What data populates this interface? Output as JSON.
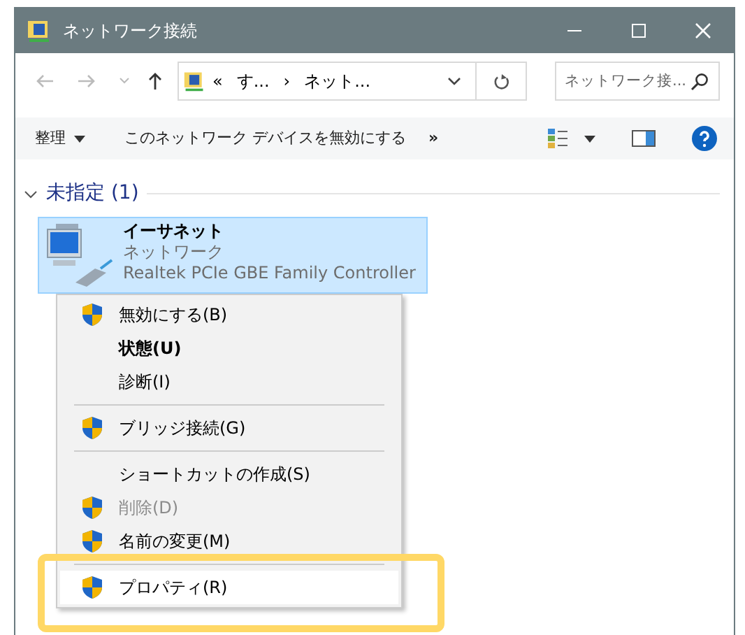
{
  "window": {
    "title": "ネットワーク接続"
  },
  "address_bar": {
    "segments": [
      "«",
      "す...",
      "›",
      "ネット..."
    ]
  },
  "search": {
    "placeholder": "ネットワーク接..."
  },
  "toolbar": {
    "organize": "整理",
    "command": "このネットワーク デバイスを無効にする",
    "more": "»"
  },
  "group": {
    "label": "未指定 (1)",
    "expanded": true
  },
  "connection": {
    "name": "イーサネット",
    "status": "ネットワーク",
    "device": "Realtek PCIe GBE Family Controller",
    "selected": true
  },
  "context_menu": [
    {
      "kind": "item",
      "label": "無効にする(B)",
      "shield": true,
      "bold": false,
      "disabled": false,
      "selected": false
    },
    {
      "kind": "item",
      "label": "状態(U)",
      "shield": false,
      "bold": true,
      "disabled": false,
      "selected": false
    },
    {
      "kind": "item",
      "label": "診断(I)",
      "shield": false,
      "bold": false,
      "disabled": false,
      "selected": false
    },
    {
      "kind": "separator"
    },
    {
      "kind": "item",
      "label": "ブリッジ接続(G)",
      "shield": true,
      "bold": false,
      "disabled": false,
      "selected": false
    },
    {
      "kind": "separator"
    },
    {
      "kind": "item",
      "label": "ショートカットの作成(S)",
      "shield": false,
      "bold": false,
      "disabled": false,
      "selected": false
    },
    {
      "kind": "item",
      "label": "削除(D)",
      "shield": true,
      "bold": false,
      "disabled": true,
      "selected": false
    },
    {
      "kind": "item",
      "label": "名前の変更(M)",
      "shield": true,
      "bold": false,
      "disabled": false,
      "selected": false
    },
    {
      "kind": "separator"
    },
    {
      "kind": "item",
      "label": "プロパティ(R)",
      "shield": true,
      "bold": false,
      "disabled": false,
      "selected": true
    }
  ]
}
